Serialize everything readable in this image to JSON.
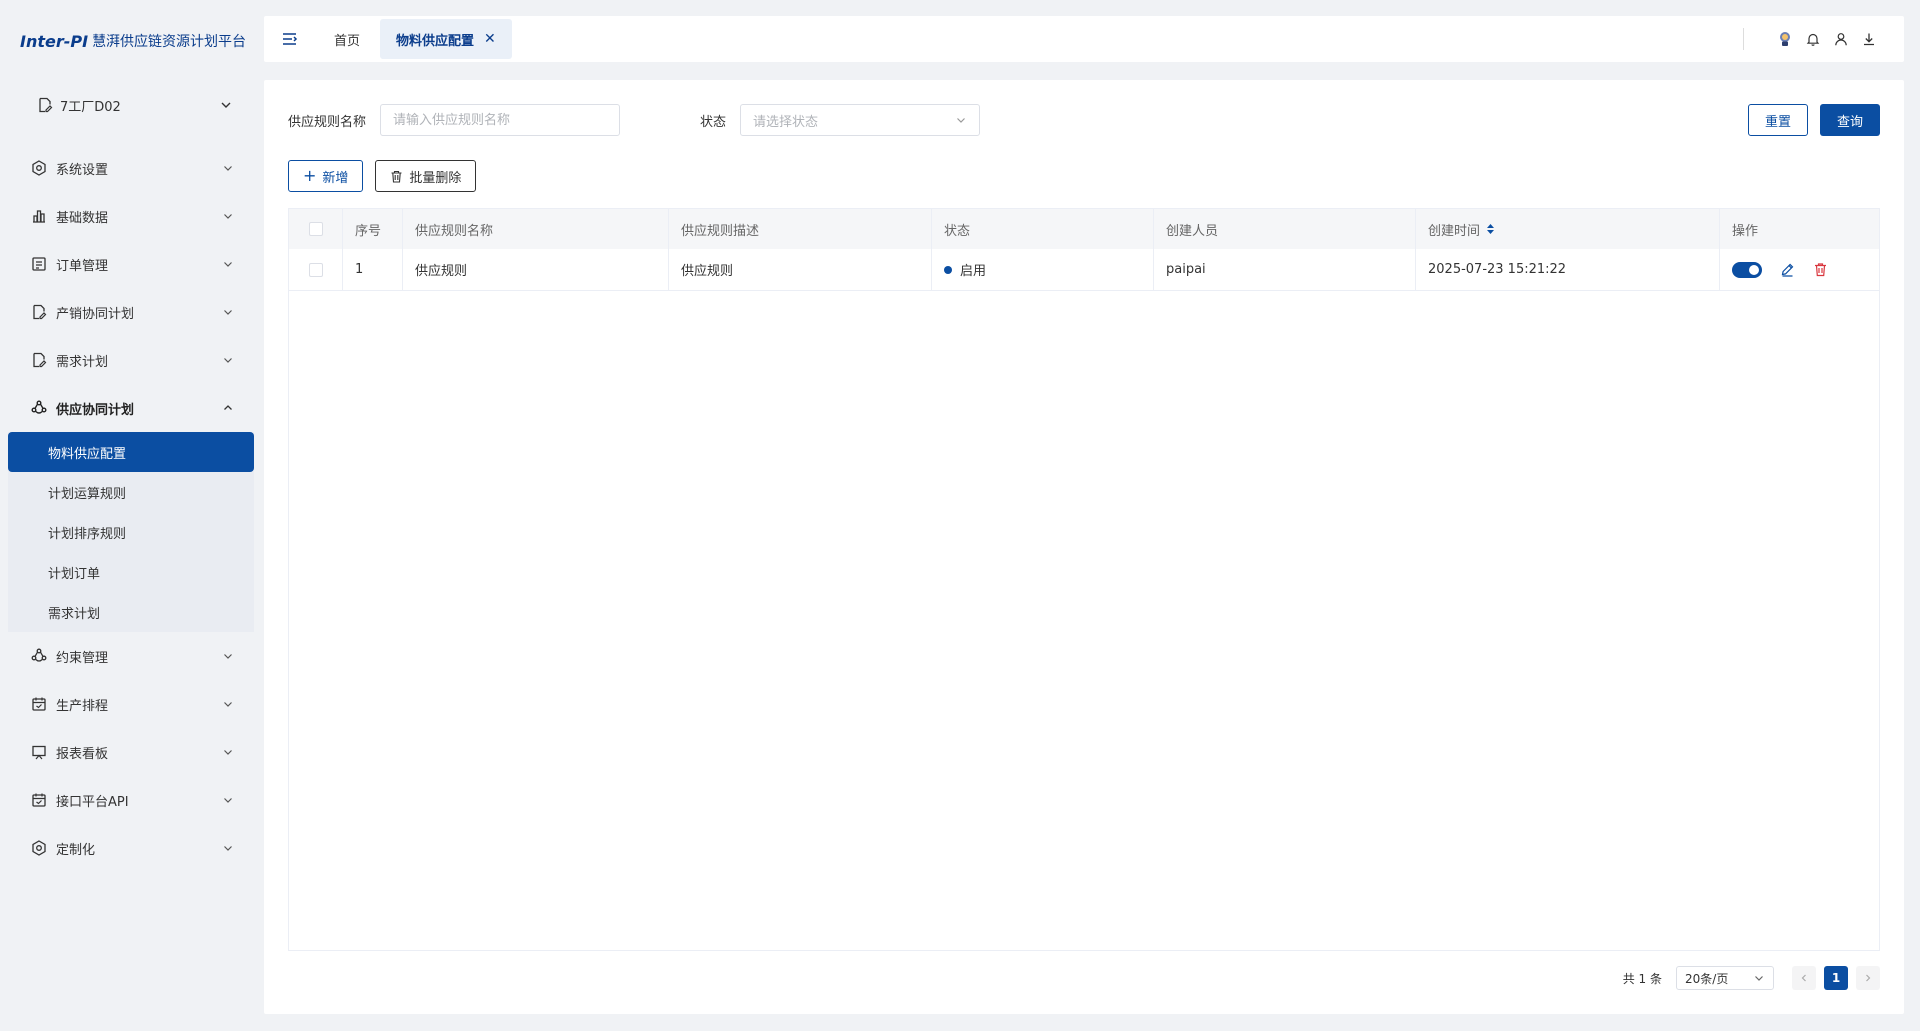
{
  "app": {
    "brand": "Inter-PI",
    "title": "慧湃供应链资源计划平台"
  },
  "factory": {
    "label": "7工厂D02"
  },
  "menu": {
    "items": [
      {
        "label": "系统设置",
        "icon": "settings-icon"
      },
      {
        "label": "基础数据",
        "icon": "bar-chart-icon"
      },
      {
        "label": "订单管理",
        "icon": "list-doc-icon"
      },
      {
        "label": "产销协同计划",
        "icon": "doc-edit-icon"
      },
      {
        "label": "需求计划",
        "icon": "doc-edit-icon"
      },
      {
        "label": "供应协同计划",
        "icon": "network-icon"
      },
      {
        "label": "约束管理",
        "icon": "network-icon"
      },
      {
        "label": "生产排程",
        "icon": "calendar-icon"
      },
      {
        "label": "报表看板",
        "icon": "board-icon"
      },
      {
        "label": "接口平台API",
        "icon": "calendar-icon"
      },
      {
        "label": "定制化",
        "icon": "settings-icon"
      }
    ],
    "submenu": [
      "物料供应配置",
      "计划运算规则",
      "计划排序规则",
      "计划订单",
      "需求计划"
    ]
  },
  "header": {
    "tabs": [
      {
        "label": "首页"
      },
      {
        "label": "物料供应配置",
        "close": "✕"
      }
    ]
  },
  "filter": {
    "name_label": "供应规则名称",
    "name_placeholder": "请输入供应规则名称",
    "status_label": "状态",
    "status_placeholder": "请选择状态",
    "reset": "重置",
    "query": "查询"
  },
  "toolbar": {
    "add": "新增",
    "batch_delete": "批量删除"
  },
  "table": {
    "columns": [
      "序号",
      "供应规则名称",
      "供应规则描述",
      "状态",
      "创建人员",
      "创建时间",
      "操作"
    ],
    "rows": [
      {
        "index": "1",
        "name": "供应规则",
        "desc": "供应规则",
        "status": "启用",
        "creator": "paipai",
        "created": "2025-07-23 15:21:22",
        "enabled": true
      }
    ]
  },
  "pagination": {
    "total": "共 1 条",
    "page_size": "20条/页",
    "current": "1"
  },
  "colors": {
    "primary": "#0b4ea2",
    "brand": "#0b3d8c",
    "danger": "#d9363e"
  }
}
